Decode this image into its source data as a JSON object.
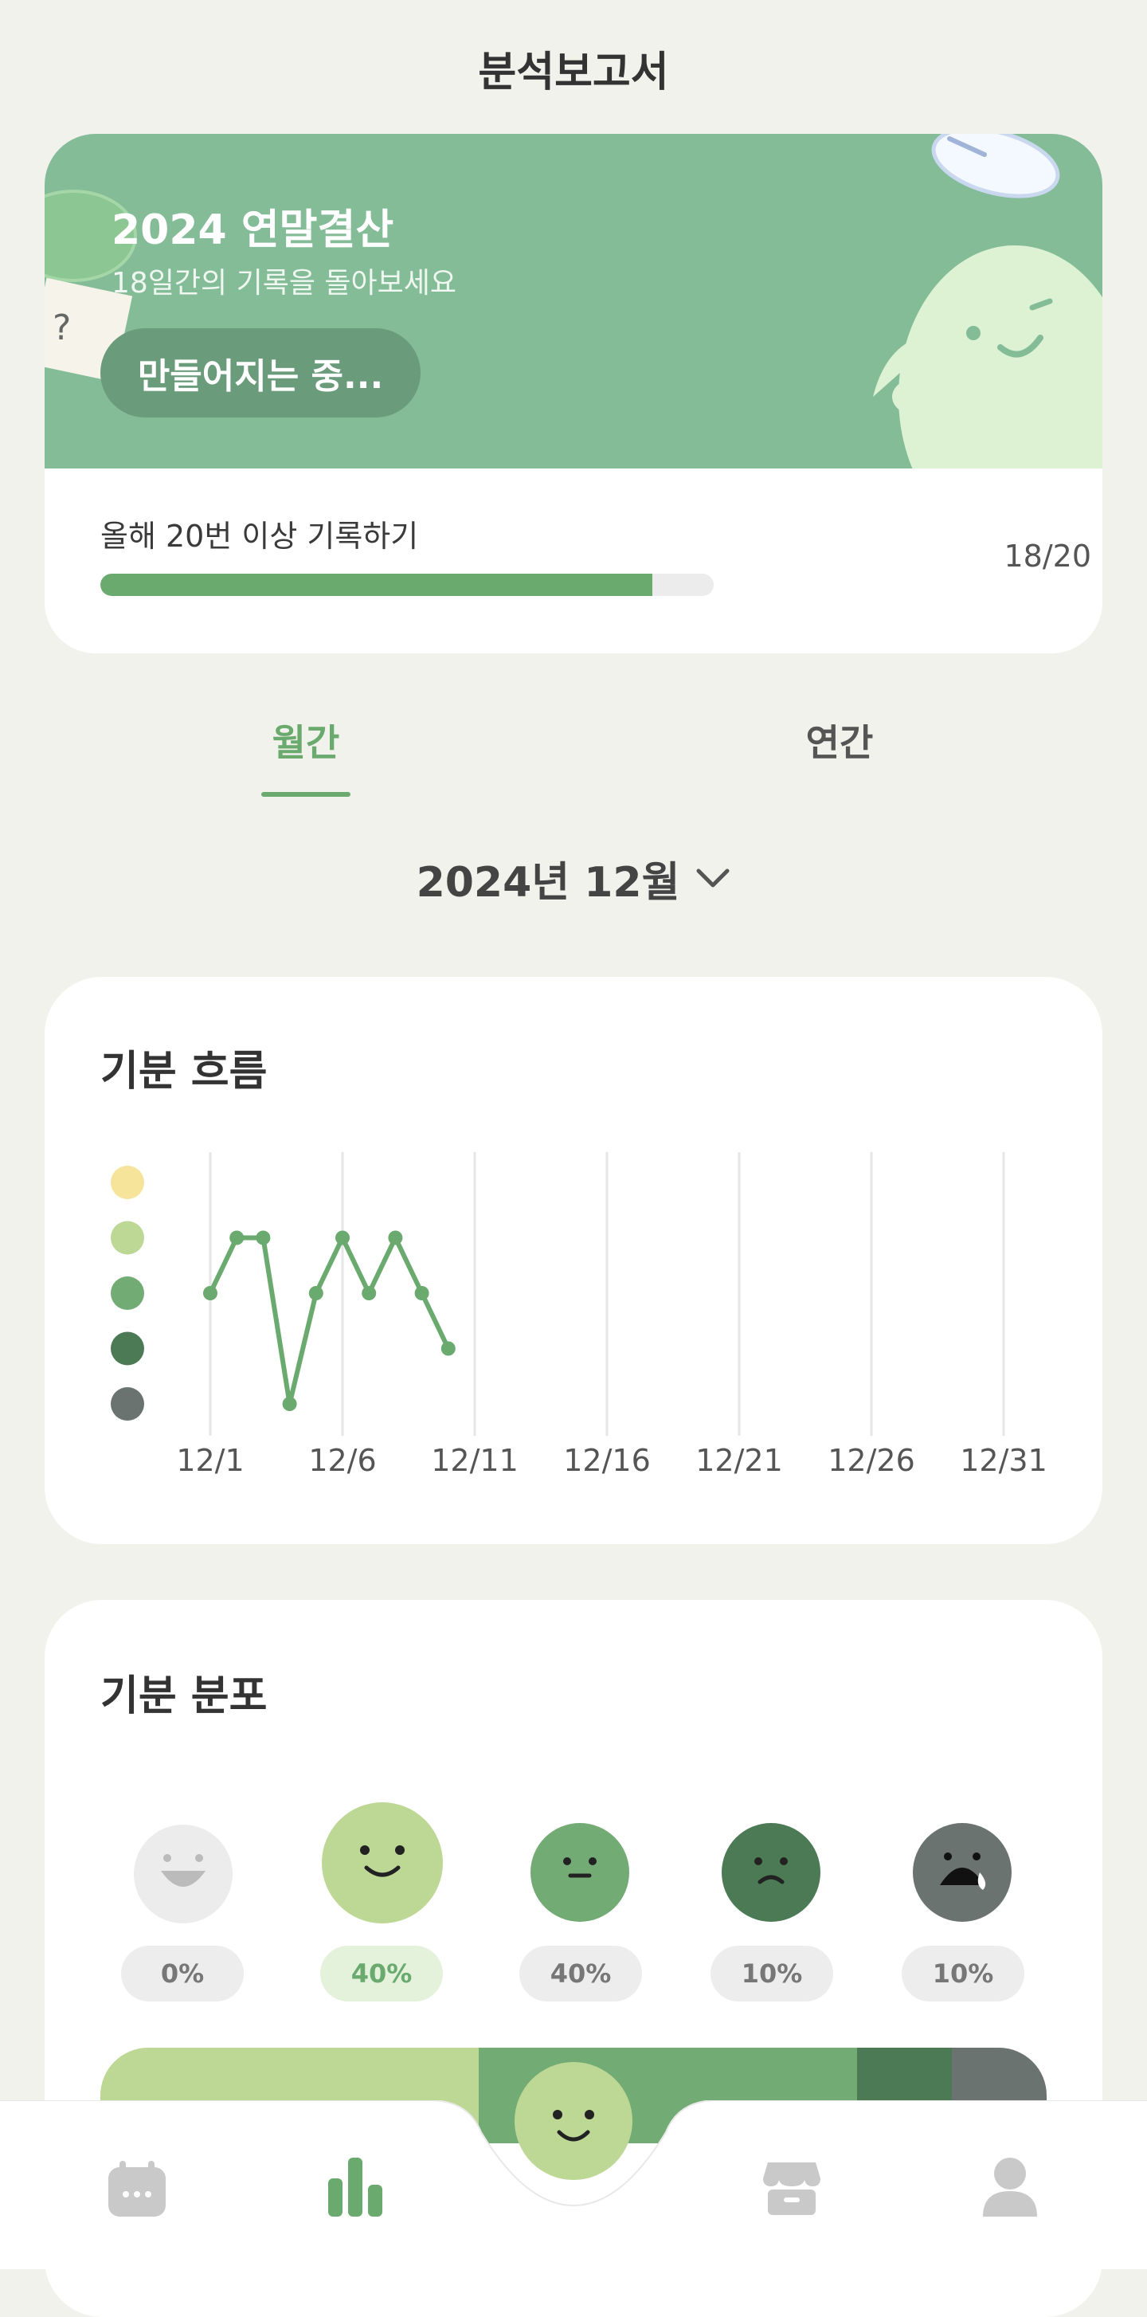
{
  "page": {
    "title": "분석보고서"
  },
  "banner": {
    "heading": "2024 연말결산",
    "subtitle": "18일간의 기록을 돌아보세요",
    "button_label": "만들어지는 중...",
    "goal_label": "올해 20번 이상 기록하기",
    "goal_count": "18/20",
    "goal_progress": 0.9
  },
  "tabs": [
    {
      "label": "월간",
      "active": true
    },
    {
      "label": "연간",
      "active": false
    }
  ],
  "month_picker": {
    "label": "2024년 12월",
    "icon": "chevron-down-icon"
  },
  "mood_flow": {
    "title": "기분 흐름",
    "mood_colors": [
      "#f6e49a",
      "#bdd795",
      "#72ab74",
      "#4b7a55",
      "#6b7370"
    ]
  },
  "mood_distribution": {
    "title": "기분 분포",
    "items": [
      {
        "face": "laugh-face-icon",
        "color": "#ececec",
        "percent": "0%",
        "active": false
      },
      {
        "face": "smile-face-icon",
        "color": "#bdd795",
        "percent": "40%",
        "active": true
      },
      {
        "face": "neutral-face-icon",
        "color": "#72ab74",
        "percent": "40%",
        "active": false
      },
      {
        "face": "sad-face-icon",
        "color": "#4b7a55",
        "percent": "10%",
        "active": false
      },
      {
        "face": "crying-face-icon",
        "color": "#6b7370",
        "percent": "10%",
        "active": false
      }
    ],
    "bar_segments": [
      {
        "color": "#bdd795",
        "fraction": 0.4
      },
      {
        "color": "#72ab74",
        "fraction": 0.4
      },
      {
        "color": "#4b7a55",
        "fraction": 0.1
      },
      {
        "color": "#6b7370",
        "fraction": 0.1
      }
    ]
  },
  "bottom_nav": {
    "items": [
      "calendar-icon",
      "stats-icon",
      "add-mood-button",
      "store-icon",
      "profile-icon"
    ],
    "active": "stats-icon"
  },
  "chart_data": {
    "type": "line",
    "title": "기분 흐름",
    "xlabel": "",
    "ylabel": "",
    "x_ticks": [
      "12/1",
      "12/6",
      "12/11",
      "12/16",
      "12/21",
      "12/26",
      "12/31"
    ],
    "x_range": [
      1,
      31
    ],
    "y_levels": 5,
    "y_range": [
      1,
      5
    ],
    "y_axis_note": "mood level 5=yellow (best) ... 1=grey (worst)",
    "series": [
      {
        "x": [
          1,
          2,
          3,
          4,
          5,
          6,
          7,
          8,
          9,
          10
        ],
        "y": [
          3,
          4,
          4,
          1,
          3,
          4,
          3,
          4,
          3,
          2
        ],
        "color": "#6aaa6e"
      }
    ],
    "grid": true
  }
}
